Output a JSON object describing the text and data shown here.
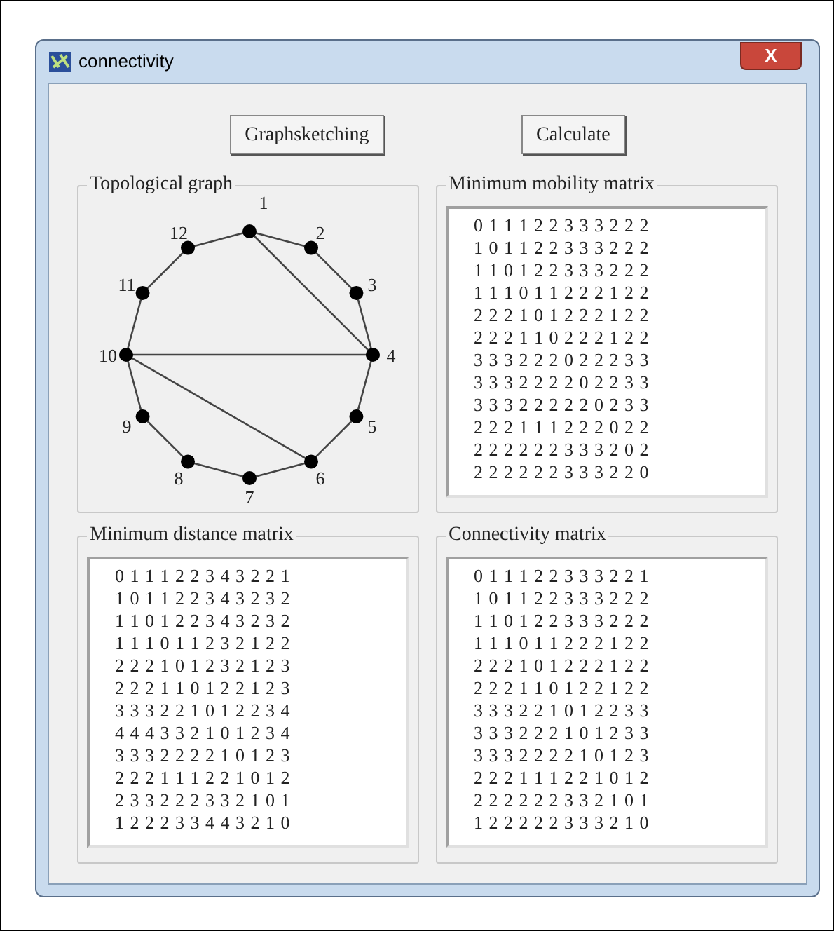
{
  "window": {
    "title": "connectivity",
    "close": "X"
  },
  "buttons": [
    {
      "label": "Graphsketching"
    },
    {
      "label": "Calculate"
    }
  ],
  "graph": {
    "title": "Topological graph",
    "nodes": [
      "1",
      "2",
      "3",
      "4",
      "5",
      "6",
      "7",
      "8",
      "9",
      "10",
      "11",
      "12"
    ]
  },
  "matrices": [
    {
      "title": "Minimum mobility matrix",
      "rows": [
        "0 1 1 1 2 2 3 3 3 2 2 2",
        "1 0 1 1 2 2 3 3 3 2 2 2",
        "1 1 0 1 2 2 3 3 3 2 2 2",
        "1 1 1 0 1 1 2 2 2 1 2 2",
        "2 2 2 1 0 1 2 2 2 1 2 2",
        "2 2 2 1 1 0 2 2 2 1 2 2",
        "3 3 3 2 2 2 0 2 2 2 3 3",
        "3 3 3 2 2 2 2 0 2 2 3 3",
        "3 3 3 2 2 2 2 2 0 2 3 3",
        "2 2 2 1 1 1 2 2 2 0 2 2",
        "2 2 2 2 2 2 3 3 3 2 0 2",
        "2 2 2 2 2 2 3 3 3 2 2 0"
      ]
    },
    {
      "title": "Minimum distance matrix",
      "rows": [
        "0 1 1 1 2 2 3 4 3 2 2 1",
        "1 0 1 1 2 2 3 4 3 2 3 2",
        "1 1 0 1 2 2 3 4 3 2 3 2",
        "1 1 1 0 1 1 2 3 2 1 2 2",
        "2 2 2 1 0 1 2 3 2 1 2 3",
        "2 2 2 1 1 0 1 2 2 1 2 3",
        "3 3 3 2 2 1 0 1 2 2 3 4",
        "4 4 4 3 3 2 1 0 1 2 3 4",
        "3 3 3 2 2 2 2 1 0 1 2 3",
        "2 2 2 1 1 1 2 2 1 0 1 2",
        "2 3 3 2 2 2 3 3 2 1 0 1",
        "1 2 2 2 3 3 4 4 3 2 1 0"
      ]
    },
    {
      "title": "Connectivity matrix",
      "rows": [
        "0 1 1 1 2 2 3 3 3 2 2 1",
        "1 0 1 1 2 2 3 3 3 2 2 2",
        "1 1 0 1 2 2 3 3 3 2 2 2",
        "1 1 1 0 1 1 2 2 2 1 2 2",
        "2 2 2 1 0 1 2 2 2 1 2 2",
        "2 2 2 1 1 0 1 2 2 1 2 2",
        "3 3 3 2 2 1 0 1 2 2 3 3",
        "3 3 3 2 2 2 1 0 1 2 3 3",
        "3 3 3 2 2 2 2 1 0 1 2 3",
        "2 2 2 1 1 1 2 2 1 0 1 2",
        "2 2 2 2 2 2 3 3 2 1 0 1",
        "1 2 2 2 2 2 3 3 3 2 1 0"
      ]
    }
  ]
}
